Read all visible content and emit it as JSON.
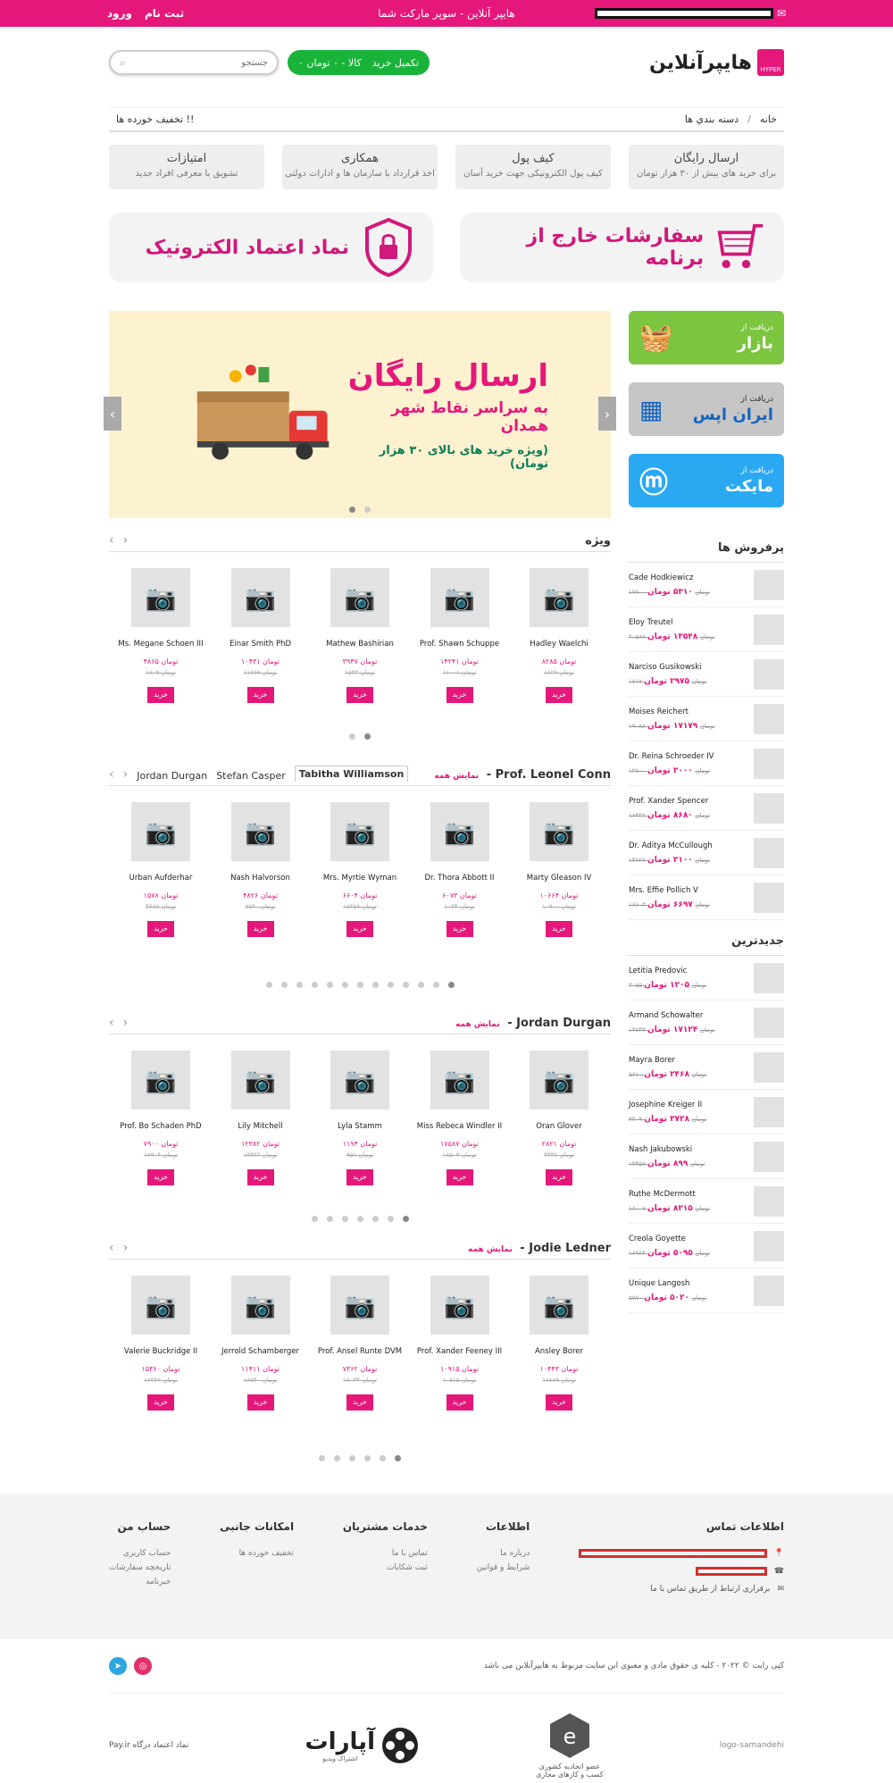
{
  "topbar": {
    "login": "ورود",
    "register": "ثبت نام",
    "tagline": "هایپر آنلاین - سوپر مارکت شما"
  },
  "header": {
    "logo_text": "هایپرآنلاین",
    "logo_sub": "HYPER",
    "search_placeholder": "جستجو",
    "cart_label": "تکمیل خرید",
    "cart_summary": "۰ کالا - ۰ تومان"
  },
  "breadcrumb": {
    "home": "خانه",
    "sep": "/",
    "categories": "دسته بندي ها",
    "discount": "تخفیف خورده ها !!"
  },
  "features": [
    {
      "title": "ارسال رایگان",
      "desc": "برای خرید های بیش از ۳۰ هزار تومان"
    },
    {
      "title": "کیف پول",
      "desc": "کیف پول الکترونیکی جهت خرید آسان"
    },
    {
      "title": "همکاری",
      "desc": "اخذ قرارداد با سازمان ها و ادارات دولتی"
    },
    {
      "title": "امتیازات",
      "desc": "تشویق با معرفی افراد جدید"
    }
  ],
  "banners": {
    "orders": "سفارشات خارج از برنامه",
    "enamad": "نماد اعتماد الکترونیک"
  },
  "slider": {
    "line1": "ارسال رایگان",
    "line2": "به سراسر نقاط شهر همدان",
    "line3": "(ویژه خرید های بالای ۳۰ هزار تومان)"
  },
  "apps": [
    {
      "top": "دریافت از",
      "name": "بازار",
      "color": "#7cc53e"
    },
    {
      "top": "دریافت از",
      "name": "ایران اپس",
      "color": "#b9b9b9"
    },
    {
      "top": "دریافت از",
      "name": "مایکت",
      "color": "#2aa9f2"
    }
  ],
  "sections": [
    {
      "title": "ویژه",
      "products": [
        {
          "name": "Hadley Waelchi",
          "price": "۸۲۸۵ تومان",
          "old": "۱۶۲۹ تومان"
        },
        {
          "name": "Prof. Shawn Schuppe",
          "price": "۱۴۲۴۱ تومان",
          "old": "۱۶۰۰۱ تومان"
        },
        {
          "name": "Mathew Bashirian",
          "price": "۳۹۴۷ تومان",
          "old": "۱۵۳۴ تومان"
        },
        {
          "name": "Einar Smith PhD",
          "price": "۱۰۴۳۱ تومان",
          "old": "۱۱۷۶۹ تومان"
        },
        {
          "name": "Ms. Megane Schoen III",
          "price": "۴۸۶۵ تومان",
          "old": "۱۸۰۹ تومان"
        }
      ]
    },
    {
      "title": "Prof. Leonel Conn",
      "all": "نمایش همه",
      "tabs": [
        "Jordan Durgan",
        "Stefan Casper",
        "Tabitha Williamson"
      ],
      "products": [
        {
          "name": "Marty Gleason IV",
          "price": "۱۰۶۶۴ تومان",
          "old": "۱۰۹۰۰ تومان"
        },
        {
          "name": "Dr. Thora Abbott II",
          "price": "۶۰۷۳ تومان",
          "old": "۱۰۳۴ تومان"
        },
        {
          "name": "Mrs. Myrtie Wyman",
          "price": "۶۶۰۴ تومان",
          "old": "۱۵۳۵۸ تومان"
        },
        {
          "name": "Nash Halvorson",
          "price": "۴۸۲۶ تومان",
          "old": "۷۵۴۰ تومان"
        },
        {
          "name": "Urban Aufderhar",
          "price": "۱۵۷۸ تومان",
          "old": "۴۶۶۸ تومان"
        }
      ]
    },
    {
      "title": "Jordan Durgan",
      "all": "نمایش همه",
      "products": [
        {
          "name": "Oran Glover",
          "price": "۲۸۲۱ تومان",
          "old": "۳۴۴۷ تومان"
        },
        {
          "name": "Miss Rebeca Windler II",
          "price": "۱۷۵۸۷ تومان",
          "old": "۱۸۵۰۳ تومان"
        },
        {
          "name": "Lyla Stamm",
          "price": "۱۱۹۴ تومان",
          "old": "۹۵۱ تومان"
        },
        {
          "name": "Lily Mitchell",
          "price": "۱۲۳۸۲ تومان",
          "old": "۱۴۴۲۲ تومان"
        },
        {
          "name": "Prof. Bo Schaden PhD",
          "price": "۷۹۰۰ تومان",
          "old": "۱۶۹۰۴ تومان"
        }
      ]
    },
    {
      "title": "Jodie Ledner",
      "all": "نمایش همه",
      "products": [
        {
          "name": "Ansley Borer",
          "price": "۱۰۴۴۳ تومان",
          "old": "۱۶۸۸۹ تومان"
        },
        {
          "name": "Prof. Xander Feeney III",
          "price": "۱۰۹۱۵ تومان",
          "old": "۱۰۵۱۵ تومان"
        },
        {
          "name": "Prof. Ansel Runte DVM",
          "price": "۷۳۶۲ تومان",
          "old": "۱۸۰۳۴ تومان"
        },
        {
          "name": "Jerrold Schamberger",
          "price": "۱۱۴۱۱ تومان",
          "old": "۱۶۵۴۰ تومان"
        },
        {
          "name": "Valerie Buckridge II",
          "price": "۱۵۳۶۰ تومان",
          "old": "۱۶۳۳۶ تومان"
        }
      ]
    }
  ],
  "buy": "خرید",
  "bestsellers": {
    "title": "پرفروش ها",
    "items": [
      {
        "name": "Cade Hodkiewicz",
        "price": "۵۳۱۰ تومان",
        "old": "۱۷۷۰۰ تومان"
      },
      {
        "name": "Eloy Treutel",
        "price": "۱۳۵۴۸ تومان",
        "old": "۲۰۵۸۷ تومان"
      },
      {
        "name": "Narciso Gusikowski",
        "price": "۲۹۷۵ تومان",
        "old": "۱۷۱۷ تومان"
      },
      {
        "name": "Moises Reichert",
        "price": "۱۷۱۷۹ تومان",
        "old": "۱۹۰۸۸ تومان"
      },
      {
        "name": "Dr. Reina Schroeder IV",
        "price": "۳۰۰۰ تومان",
        "old": "۱۲۷۰۰ تومان"
      },
      {
        "name": "Prof. Xander Spencer",
        "price": "۸۶۸۰ تومان",
        "old": "۱۶۳۲۲ تومان"
      },
      {
        "name": "Dr. Aditya McCullough",
        "price": "۳۱۰۰ تومان",
        "old": "۱۳۶۲۷ تومان"
      },
      {
        "name": "Mrs. Effie Pollich V",
        "price": "۶۶۹۷ تومان",
        "old": "۱۶۶۰۳ تومان"
      }
    ]
  },
  "newest": {
    "title": "جدیدترین",
    "items": [
      {
        "name": "Letitia Predovic",
        "price": "۱۲۰۵ تومان",
        "old": "۳۰۵۵ تومان"
      },
      {
        "name": "Armand Schowalter",
        "price": "۱۷۱۲۴ تومان",
        "old": "۱۴۷۴۳ تومان"
      },
      {
        "name": "Mayra Borer",
        "price": "۲۴۶۸ تومان",
        "old": "۵۶۱۰ تومان"
      },
      {
        "name": "Josephine Kreiger II",
        "price": "۳۷۲۸ تومان",
        "old": "۴۳۰۹ تومان"
      },
      {
        "name": "Nash Jakubowski",
        "price": "۸۹۹ تومان",
        "old": "۱۳۴۵۷ تومان"
      },
      {
        "name": "Ruthe McDermott",
        "price": "۸۲۱۵ تومان",
        "old": "۱۶۰۰۷ تومان"
      },
      {
        "name": "Creola Goyette",
        "price": "۵۰۹۵ تومان",
        "old": "۱۶۹۶۳ تومان"
      },
      {
        "name": "Unique Langosh",
        "price": "۵۰۲۰ تومان",
        "old": "۵۷۷۰ تومان"
      }
    ]
  },
  "footer": {
    "contact_title": "اطلاعات تماس",
    "contact_link": "برقراری ارتباط از طریق تماس با ما",
    "info_title": "اطلاعات",
    "info": [
      "درباره ما",
      "شرایط و قوانین"
    ],
    "services_title": "خدمات مشتریان",
    "services": [
      "تماس با ما",
      "ثبت شکایات"
    ],
    "extras_title": "امکانات جانبی",
    "extras": [
      "تخفیف خورده ها"
    ],
    "account_title": "حساب من",
    "account": [
      "حساب کاربری",
      "تاریخچه سفارشات",
      "خبرنامه"
    ],
    "copyright": "کپی رایت © ۲۰۲۲ - کلیه ی حقوق مادی و معنوی این سایت مربوط به هایپرآنلاین می باشد",
    "samandehi": "logo-samandehi",
    "union": "عضو اتحادیه کشوری\nکسب و کارهای مجازی",
    "aparat": "آپارات",
    "aparat_sub": "اشتراک ویدیو",
    "payir": "نماد اعتماد درگاه Pay.ir"
  }
}
